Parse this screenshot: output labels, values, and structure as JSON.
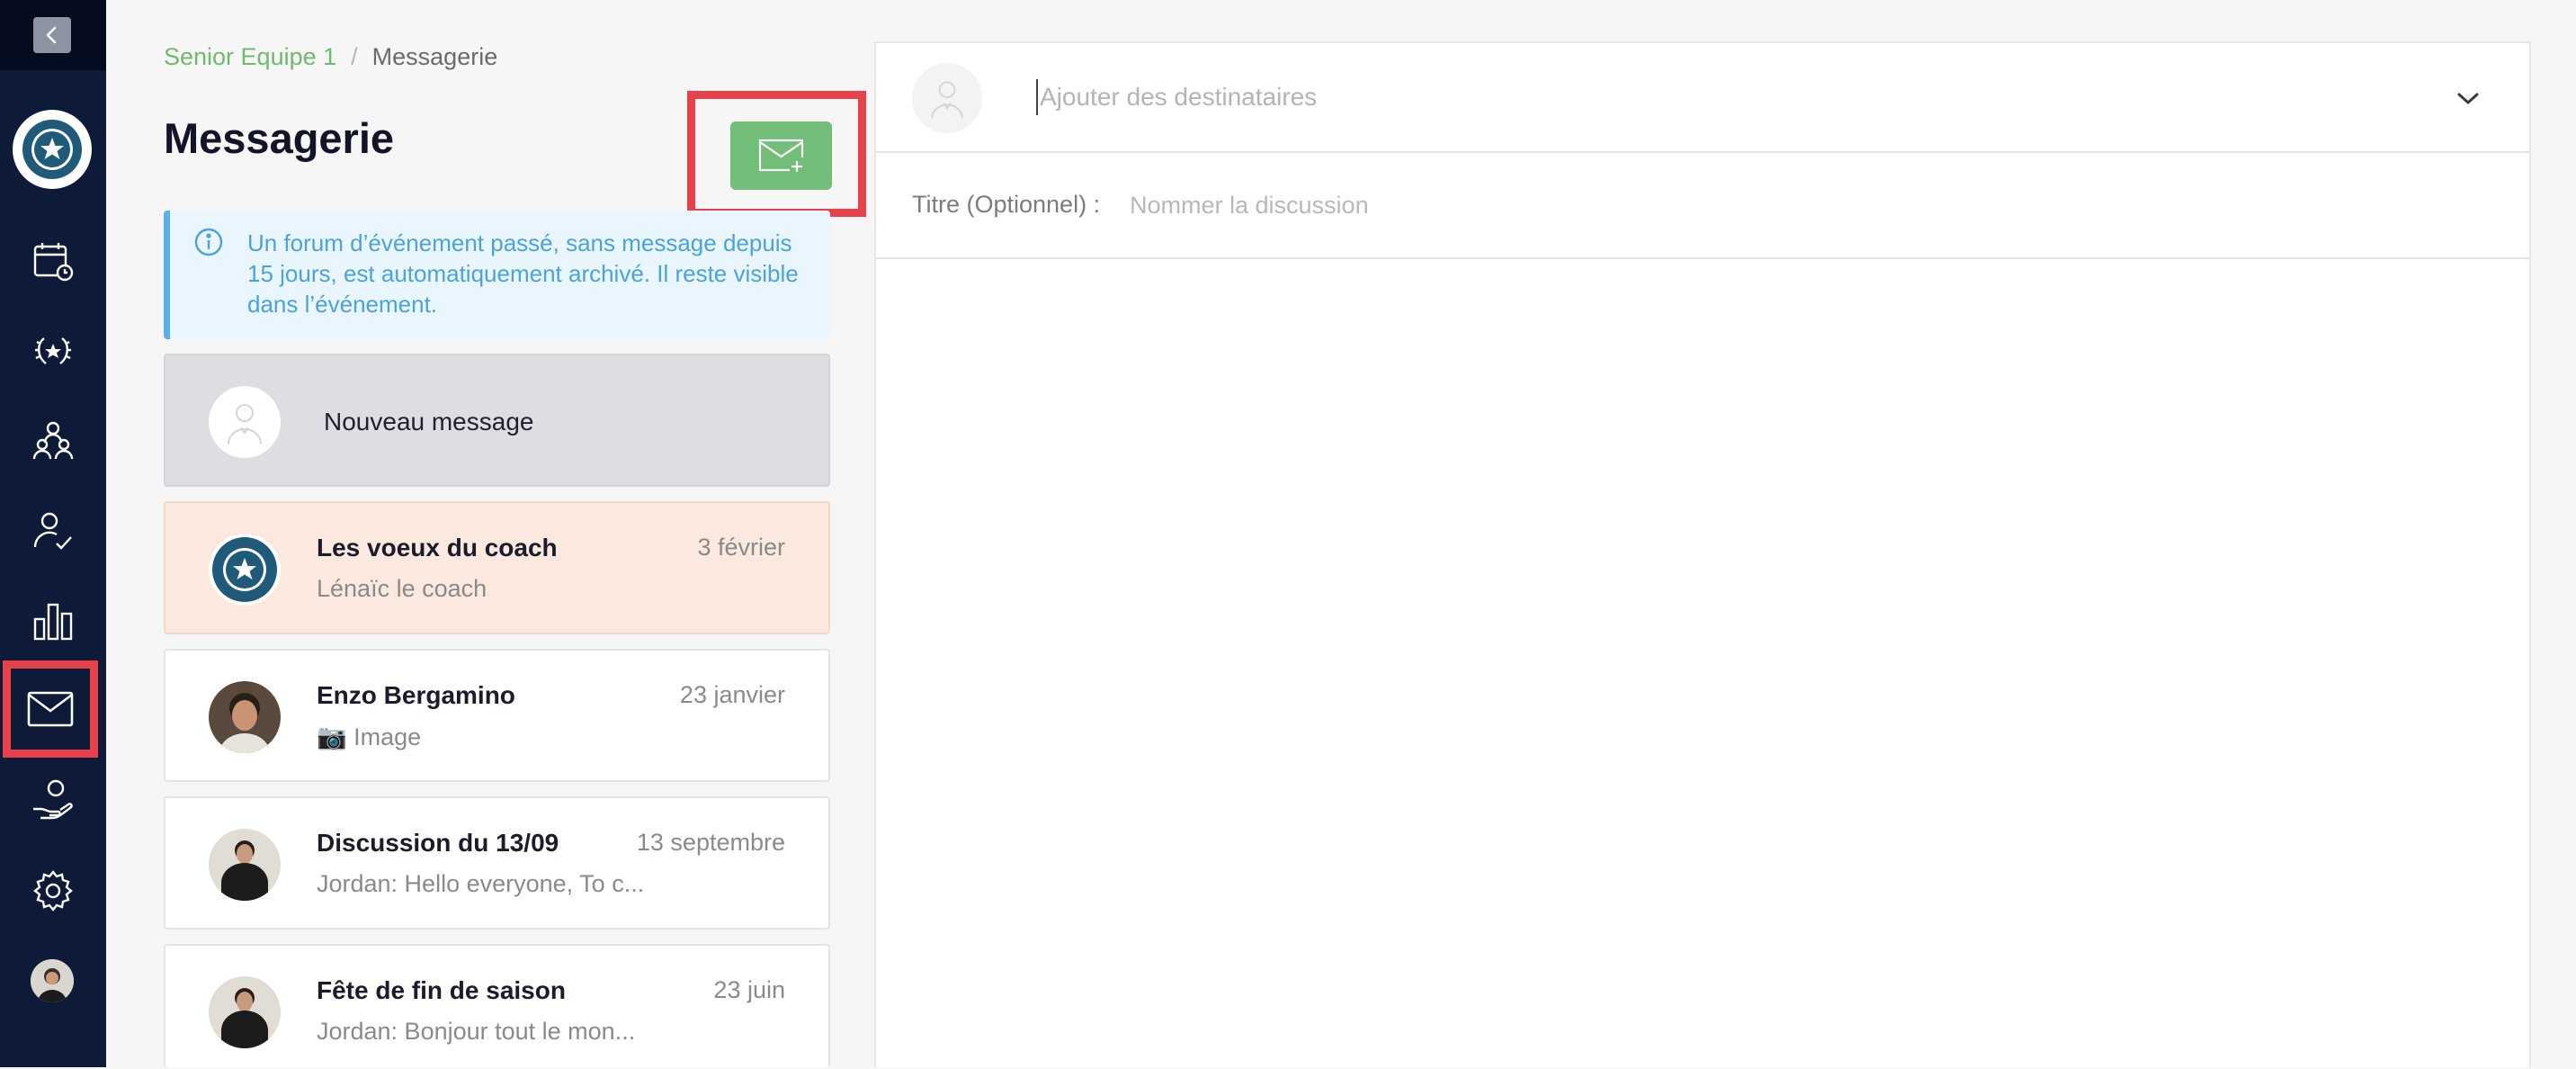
{
  "breadcrumb": {
    "team": "Senior Equipe 1",
    "separator": "/",
    "current": "Messagerie"
  },
  "page": {
    "title": "Messagerie"
  },
  "info_banner": {
    "text": "Un forum d’événement passé, sans message depuis 15 jours, est automatiquement archivé. Il reste visible dans l’événement."
  },
  "new_message": {
    "label": "Nouveau message"
  },
  "conversations": [
    {
      "title": "Les voeux du coach",
      "date": "3 février",
      "preview": "Lénaïc le coach",
      "avatar": "club-logo"
    },
    {
      "title": "Enzo Bergamino",
      "date": "23 janvier",
      "preview": "📷 Image",
      "avatar": "user-photo"
    },
    {
      "title": "Discussion du 13/09",
      "date": "13 septembre",
      "preview": "Jordan: Hello everyone, To c...",
      "avatar": "user-photo"
    },
    {
      "title": "Fête de fin de saison",
      "date": "23 juin",
      "preview": "Jordan: Bonjour tout le mon...",
      "avatar": "user-photo"
    }
  ],
  "compose": {
    "recipients_placeholder": "Ajouter des destinataires",
    "title_label": "Titre (Optionnel) :",
    "title_placeholder": "Nommer la discussion"
  },
  "sidebar": {
    "items": [
      "calendar-icon",
      "trophy-icon",
      "team-icon",
      "attendance-icon",
      "stats-icon",
      "mail-icon",
      "hand-heart-icon",
      "settings-icon"
    ],
    "active": "mail-icon"
  },
  "colors": {
    "sidebar": "#0d1a38",
    "accent_green": "#72bd78",
    "highlight_red": "#e7424c",
    "info_blue": "#4aa2de",
    "selected_conv": "#fbe8de"
  }
}
